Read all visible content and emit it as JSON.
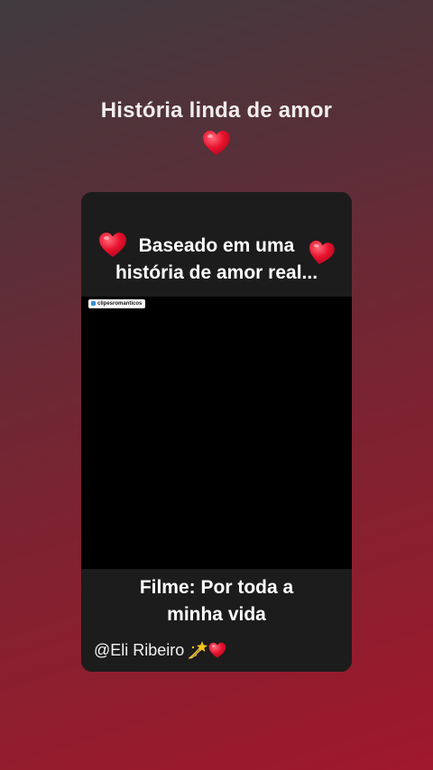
{
  "header": {
    "title": "História linda de amor",
    "icon": "red-heart-icon"
  },
  "card": {
    "top_caption_line1": "Baseado em uma",
    "top_caption_line2": "história de amor real...",
    "watermark": "clipesromanticos",
    "bottom_caption_line1": "Filme: Por toda a",
    "bottom_caption_line2": "minha vida",
    "credit": "@Eli Ribeiro",
    "credit_icons": [
      "dizzy-sparkle-icon",
      "red-heart-icon"
    ]
  },
  "colors": {
    "heart": "#e8112d",
    "card_background": "#1c1c1c",
    "video_background": "#000000",
    "gradient_top": "#3f3a3f",
    "gradient_bottom": "#a0182b"
  }
}
